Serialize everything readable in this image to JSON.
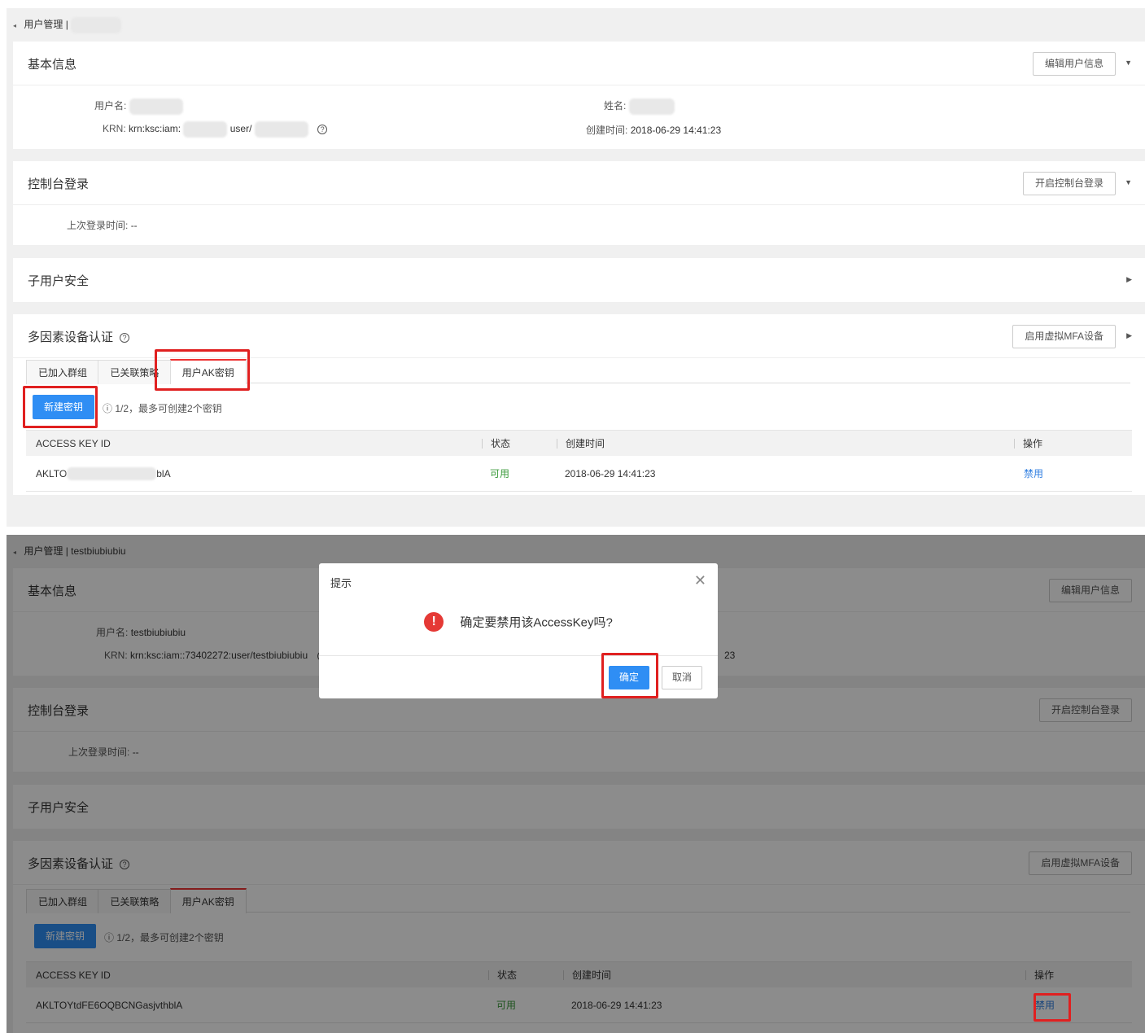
{
  "screen1": {
    "breadcrumb": {
      "back_icon": "chevron-left-icon",
      "text": "用户管理 |"
    },
    "basic_info": {
      "title": "基本信息",
      "edit_button": "编辑用户信息",
      "username_label": "用户名:",
      "realname_label": "姓名:",
      "krn_label": "KRN:",
      "krn_value_prefix": "krn:ksc:iam:",
      "krn_value_mid": "user/",
      "created_label": "创建时间:",
      "created_value": "2018-06-29 14:41:23"
    },
    "console_login": {
      "title": "控制台登录",
      "button": "开启控制台登录",
      "last_login_label": "上次登录时间:",
      "last_login_value": "--"
    },
    "sub_user_security": {
      "title": "子用户安全"
    },
    "mfa": {
      "title": "多因素设备认证",
      "button": "启用虚拟MFA设备",
      "tabs": [
        "已加入群组",
        "已关联策略",
        "用户AK密钥"
      ],
      "new_key_button": "新建密钥",
      "hint": "ⓘ  1/2，最多可创建2个密钥",
      "table": {
        "headers": [
          "ACCESS KEY ID",
          "状态",
          "创建时间",
          "操作"
        ],
        "rows": [
          {
            "id_start": "AKLTO",
            "id_end": "blA",
            "status": "可用",
            "created": "2018-06-29 14:41:23",
            "action": "禁用"
          }
        ]
      }
    }
  },
  "screen2": {
    "breadcrumb": {
      "text": "用户管理 | testbiubiubiu"
    },
    "basic_info": {
      "title": "基本信息",
      "edit_button": "编辑用户信息",
      "username_label": "用户名:",
      "username_value": "testbiubiubiu",
      "krn_label": "KRN:",
      "krn_value": "krn:ksc:iam::73402272:user/testbiubiubiu",
      "created_partial": "23"
    },
    "console_login": {
      "title": "控制台登录",
      "button": "开启控制台登录",
      "last_login_label": "上次登录时间:",
      "last_login_value": "--"
    },
    "sub_user_security": {
      "title": "子用户安全"
    },
    "mfa": {
      "title": "多因素设备认证",
      "button": "启用虚拟MFA设备",
      "tabs": [
        "已加入群组",
        "已关联策略",
        "用户AK密钥"
      ],
      "new_key_button": "新建密钥",
      "hint": "ⓘ  1/2，最多可创建2个密钥",
      "table": {
        "headers": [
          "ACCESS KEY ID",
          "状态",
          "创建时间",
          "操作"
        ],
        "rows": [
          {
            "id": "AKLTOYtdFE6OQBCNGasjvthblA",
            "status": "可用",
            "created": "2018-06-29 14:41:23",
            "action": "禁用"
          }
        ]
      }
    },
    "dialog": {
      "title": "提示",
      "close_icon": "close-icon",
      "warning_icon": "exclamation-circle-icon",
      "message": "确定要禁用该AccessKey吗?",
      "ok_button": "确定",
      "cancel_button": "取消"
    }
  },
  "colors": {
    "primary": "#2f8ef4",
    "highlight_box": "#e02020",
    "status_ok": "#3a9a3a",
    "link": "#2f7ee0"
  }
}
